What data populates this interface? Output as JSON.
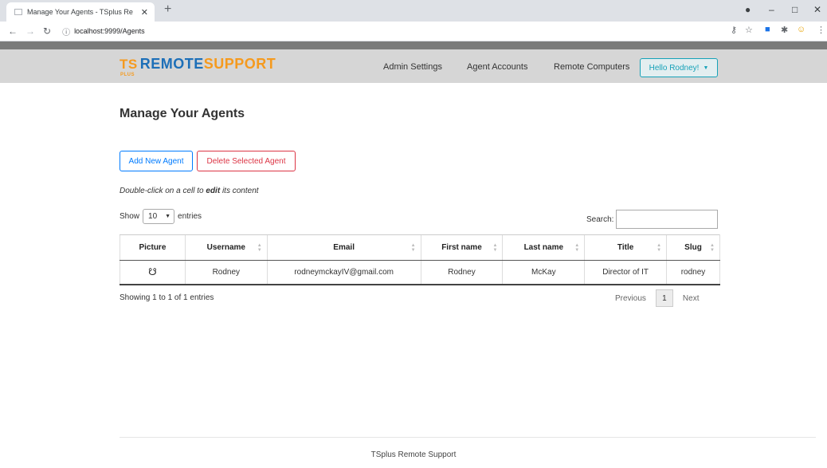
{
  "browser": {
    "tab_title": "Manage Your Agents - TSplus Re",
    "tab_close": "✕",
    "new_tab": "+",
    "address": "localhost:9999/Agents",
    "window_controls": [
      "–",
      "□",
      "✕"
    ]
  },
  "navbar": {
    "brand_ts": "TS",
    "brand_plus": "PLUS",
    "brand_remote": "REMOTE",
    "brand_support": "SUPPORT",
    "links": [
      "Admin Settings",
      "Agent Accounts",
      "Remote Computers"
    ],
    "user_menu": "Hello Rodney!"
  },
  "page": {
    "title": "Manage Your Agents",
    "add_button": "Add New Agent",
    "delete_button": "Delete Selected Agent",
    "hint_prefix": "Double-click on a cell to ",
    "hint_bold": "edit",
    "hint_suffix": " its content",
    "show_label": "Show",
    "show_value": "10",
    "entries_label": "entries",
    "search_label": "Search:",
    "search_value": ""
  },
  "table": {
    "headers": [
      "Picture",
      "Username",
      "Email",
      "First name",
      "Last name",
      "Title",
      "Slug"
    ],
    "rows": [
      {
        "username": "Rodney",
        "email": "rodneymckayIV@gmail.com",
        "first_name": "Rodney",
        "last_name": "McKay",
        "title": "Director of IT",
        "slug": "rodney"
      }
    ]
  },
  "pagination": {
    "info": "Showing 1 to 1 of 1 entries",
    "previous": "Previous",
    "current": "1",
    "next": "Next"
  },
  "footer": {
    "text": "TSplus Remote Support"
  }
}
